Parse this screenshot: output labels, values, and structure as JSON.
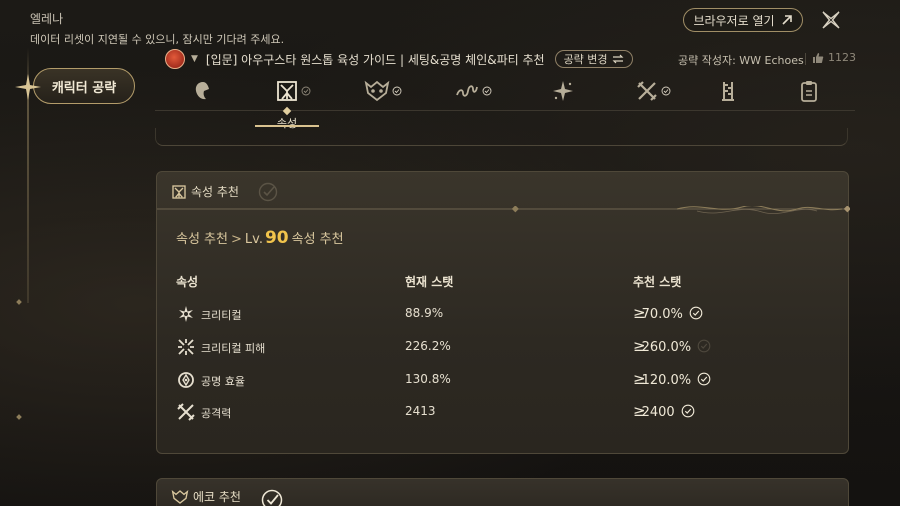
{
  "app": {
    "title": "엘레나",
    "notice": "데이터 리셋이 지연될 수 있으니, 잠시만 기다려 주세요."
  },
  "header": {
    "open_browser_label": "브라우저로 열기",
    "open_browser_icon": "arrow-up-right-icon",
    "close_icon": "close-x-icon"
  },
  "sidebar": {
    "active_label": "캐릭터 공략"
  },
  "guide": {
    "title": "[입문] 아우구스타 원스톱 육성 가이드 | 세팅&공명 체인&파티 추천",
    "change_label": "공략 변경",
    "author": "공략 작성자: WW Echoes",
    "likes": "1123"
  },
  "tabs": [
    {
      "id": "character",
      "icon": "character-portrait-icon",
      "checked": false
    },
    {
      "id": "attribute",
      "icon": "attribute-banner-icon",
      "checked": true,
      "active": true,
      "label": "속성"
    },
    {
      "id": "echo",
      "icon": "echo-mask-icon",
      "checked": true
    },
    {
      "id": "chain",
      "icon": "resonance-chain-icon",
      "checked": true
    },
    {
      "id": "skill",
      "icon": "skill-star-icon",
      "checked": false
    },
    {
      "id": "weapon",
      "icon": "crossed-swords-icon",
      "checked": true
    },
    {
      "id": "party",
      "icon": "party-figures-icon",
      "checked": false
    },
    {
      "id": "memo",
      "icon": "memo-clipboard-icon",
      "checked": false
    }
  ],
  "attribute_panel": {
    "title": "속성 추천",
    "breadcrumb_root": "속성 추천",
    "breadcrumb_sep": ">",
    "level_prefix": "Lv.",
    "level_value": "90",
    "level_suffix": "속성 추천",
    "columns": {
      "attr": "속성",
      "current": "현재 스탯",
      "recommended": "추천 스탯"
    },
    "rows": [
      {
        "name": "크리티컬",
        "icon": "crit-rate-icon",
        "current": "88.9%",
        "recommended": "70.0%",
        "met": true
      },
      {
        "name": "크리티컬 피해",
        "icon": "crit-damage-icon",
        "current": "226.2%",
        "recommended": "260.0%",
        "met": false
      },
      {
        "name": "공명 효율",
        "icon": "energy-regen-icon",
        "current": "130.8%",
        "recommended": "120.0%",
        "met": true
      },
      {
        "name": "공격력",
        "icon": "attack-icon",
        "current": "2413",
        "recommended": "2400",
        "met": true
      }
    ],
    "ge_symbol": "≥"
  },
  "echo_panel": {
    "title": "에코 추천"
  },
  "colors": {
    "accent_gold": "#f1c44c",
    "border_gold": "#a08e66",
    "bg": "#161411"
  }
}
